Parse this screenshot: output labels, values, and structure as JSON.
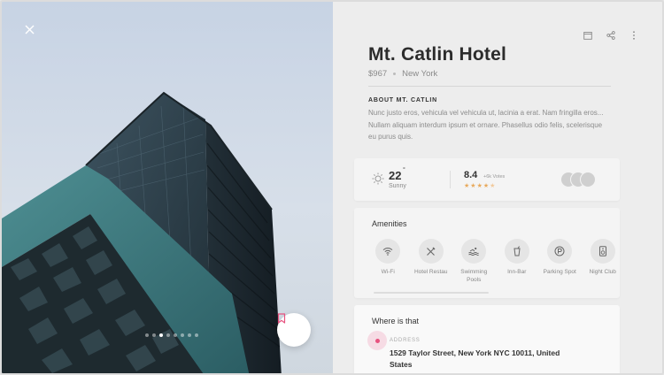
{
  "hotel": {
    "name": "Mt. Catlin Hotel",
    "price": "$967",
    "city": "New York"
  },
  "about": {
    "heading": "ABOUT MT. CATLIN",
    "text": "Nunc justo eros, vehicula vel vehicula ut, lacinia a erat. Nam fringilla eros... Nullam aliquam interdum ipsum et ornare. Phasellus odio felis, scelerisque eu purus quis."
  },
  "weather": {
    "temperature": "22",
    "unit": "°",
    "condition": "Sunny"
  },
  "reviews": {
    "rating": "8.4",
    "votes": "+6k Votes",
    "stars_filled": 4,
    "stars_total": 5
  },
  "amenities": {
    "heading": "Amenities",
    "items": [
      {
        "label": "Wi-Fi",
        "icon": "wifi-icon"
      },
      {
        "label": "Hotel Restau",
        "icon": "fork-knife-icon"
      },
      {
        "label": "Swimming Pools",
        "icon": "pool-icon"
      },
      {
        "label": "Inn-Bar",
        "icon": "drink-icon"
      },
      {
        "label": "Parking Spot",
        "icon": "parking-icon"
      },
      {
        "label": "Night Club",
        "icon": "speaker-icon"
      }
    ]
  },
  "location": {
    "heading": "Where is that",
    "address_label": "ADDRESS",
    "address": "1529 Taylor Street, New York NYC 10011, United States"
  },
  "gallery": {
    "slide_count": 8,
    "active_slide": 2
  },
  "colors": {
    "accent": "#e7527f",
    "star": "#e8a95b",
    "panel_bg": "#ededed"
  }
}
